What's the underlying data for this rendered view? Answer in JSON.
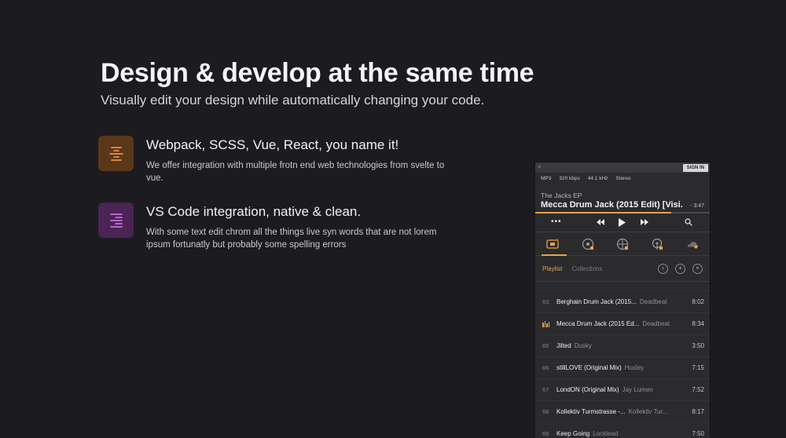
{
  "hero": {
    "title": "Design & develop at the same time",
    "subtitle": "Visually edit your design while automatically changing your code."
  },
  "features": [
    {
      "icon": "text-align-center-icon",
      "icon_color": "#e8913a",
      "title": "Webpack, SCSS, Vue, React, you name it!",
      "description": "We offer integration with multiple frotn end web technologies from svelte to vue."
    },
    {
      "icon": "text-align-right-icon",
      "icon_color": "#c56de0",
      "title": "VS Code integration, native & clean.",
      "description": "With some text edit chrom all the things live syn words that are not lorem ipsum fortunatly but probably some spelling errors"
    }
  ],
  "player": {
    "sign_in": "SIGN IN",
    "meta": [
      "MP3",
      "320 kbps",
      "44.1 kHz",
      "Stereo"
    ],
    "album": "The Jacks EP",
    "track": "Mecca Drum Jack (2015 Edit) [Visi...",
    "time": "- 3:47",
    "progress": 0.78,
    "accent": "#e8a14a",
    "tabs": {
      "playlist": "Playlist",
      "collections": "Collections"
    },
    "rows": [
      {
        "num": "63",
        "title": "Berghain Drum Jack (2015...",
        "artist": "Deadbeat",
        "duration": "8:02"
      },
      {
        "num": "",
        "playing": true,
        "title": "Mecca Drum Jack (2015 Ed...",
        "artist": "Deadbeat",
        "duration": "8:34"
      },
      {
        "num": "65",
        "title": "Jilted",
        "artist": "Dusky",
        "duration": "3:50"
      },
      {
        "num": "66",
        "title": "stillLOVE (Original Mix)",
        "artist": "Huxley",
        "duration": "7:15"
      },
      {
        "num": "67",
        "title": "LondON (Original Mix)",
        "artist": "Jay Lumen",
        "duration": "7:52"
      },
      {
        "num": "68",
        "title": "Kollektiv Turmstrasse -...",
        "artist": "Kollektiv Tur...",
        "duration": "8:17"
      },
      {
        "num": "69",
        "title": "Keep Going",
        "artist": "Locklead",
        "duration": "7:50"
      }
    ]
  }
}
